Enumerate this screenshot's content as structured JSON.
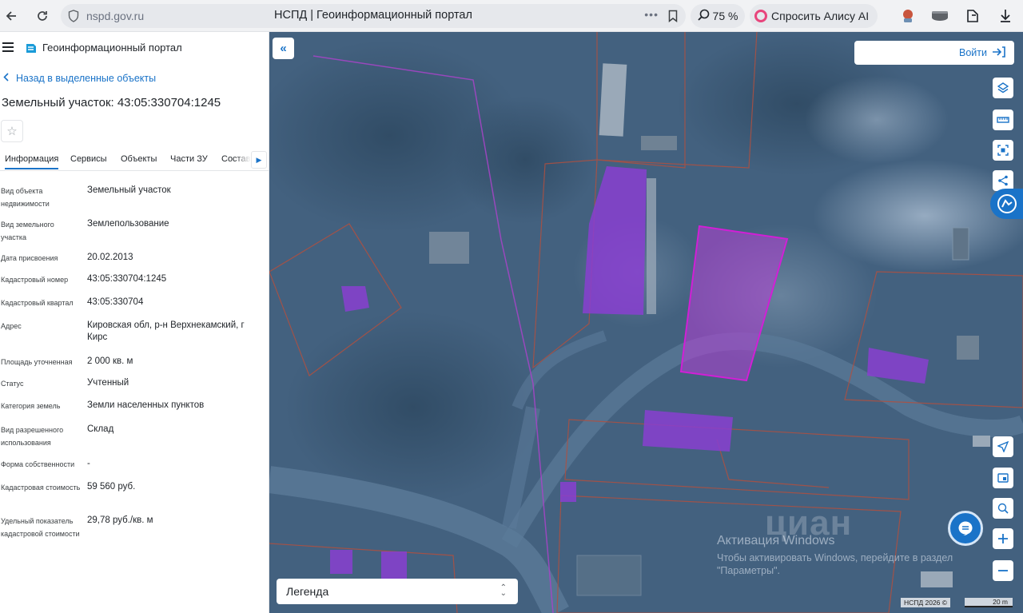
{
  "browser": {
    "url": "nspd.gov.ru",
    "tab_title": "НСПД | Геоинформационный портал",
    "zoom": "75 %",
    "alice_label": "Спросить Алису AI",
    "icons": [
      "back-arrow-icon",
      "reload-icon",
      "shield-icon",
      "bookmark-icon",
      "zoom-icon",
      "extension-icon",
      "download-icon"
    ]
  },
  "panel": {
    "portal_title": "Геоинформационный портал",
    "back_link": "Назад в выделенные объекты",
    "object_title": "Земельный участок: 43:05:330704:1245",
    "tabs": [
      "Информация",
      "Сервисы",
      "Объекты",
      "Части ЗУ",
      "Состав"
    ],
    "active_tab": "Информация",
    "fields": [
      {
        "label": "Вид объекта недвижимости",
        "value": "Земельный участок"
      },
      {
        "label": "Вид земельного участка",
        "value": "Землепользование"
      },
      {
        "label": "Дата присвоения",
        "value": "20.02.2013"
      },
      {
        "label": "Кадастровый номер",
        "value": "43:05:330704:1245"
      },
      {
        "label": "Кадастровый квартал",
        "value": "43:05:330704"
      },
      {
        "label": "Адрес",
        "value": "Кировская обл, р-н Верхнекамский, г Кирс"
      },
      {
        "label": "Площадь уточненная",
        "value": "2 000 кв. м"
      },
      {
        "label": "Статус",
        "value": "Учтенный"
      },
      {
        "label": "Категория земель",
        "value": "Земли населенных пунктов"
      },
      {
        "label": "Вид разрешенного использования",
        "value": "Склад"
      },
      {
        "label": "Форма собственности",
        "value": "-"
      },
      {
        "label": "Кадастровая стоимость",
        "value": "59 560 руб."
      },
      {
        "label": "Удельный показатель кадастровой стоимости",
        "value": "29,78 руб./кв. м"
      }
    ]
  },
  "map": {
    "login_label": "Войти",
    "legend_label": "Легенда",
    "watermark_title": "Активация Windows",
    "watermark_text": "Чтобы активировать Windows, перейдите в раздел \"Параметры\".",
    "cian_watermark": "циан",
    "copyright": "НСПД 2026 ©",
    "scale_label": "20 m",
    "tool_icons": [
      "layers-icon",
      "ruler-icon",
      "area-select-icon",
      "share-icon",
      "assistant-icon",
      "locate-icon",
      "print-icon",
      "geo-search-icon",
      "zoom-in-icon",
      "zoom-out-icon"
    ],
    "colors": {
      "accent": "#1a73c8",
      "selected_parcel": "#d11fd6",
      "parcel_outline": "#c0463a",
      "building_fill": "#8a3fd1",
      "map_tint": "#3f5d82"
    }
  }
}
